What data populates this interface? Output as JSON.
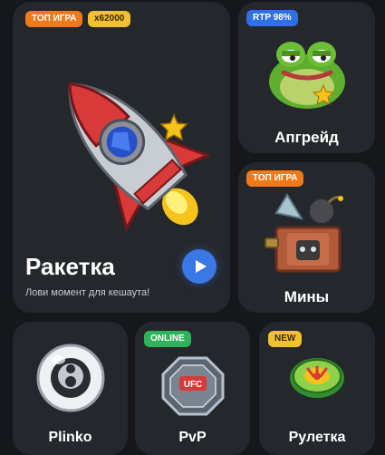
{
  "raketka": {
    "badge_top": "ТОП ИГРА",
    "badge_multiplier": "x62000",
    "title": "Ракетка",
    "subtitle": "Лови момент для кешаута!",
    "play_icon": "play-icon"
  },
  "upgrade": {
    "badge": "RTP 98%",
    "title": "Апгрейд"
  },
  "mines": {
    "badge": "ТОП ИГРА",
    "title": "Мины"
  },
  "plinko": {
    "title": "Plinko"
  },
  "pvp": {
    "badge": "ONLINE",
    "title": "PvP",
    "ring_text": "UFC"
  },
  "roulette": {
    "badge": "NEW",
    "title": "Рулетка"
  },
  "colors": {
    "background": "#15171b",
    "card": "#24272c",
    "badge_orange": "#f07a1a",
    "badge_blue": "#2f6fe8",
    "badge_green": "#2fb35a",
    "badge_yellow": "#f2c12e",
    "play_button": "#3a78e6"
  }
}
